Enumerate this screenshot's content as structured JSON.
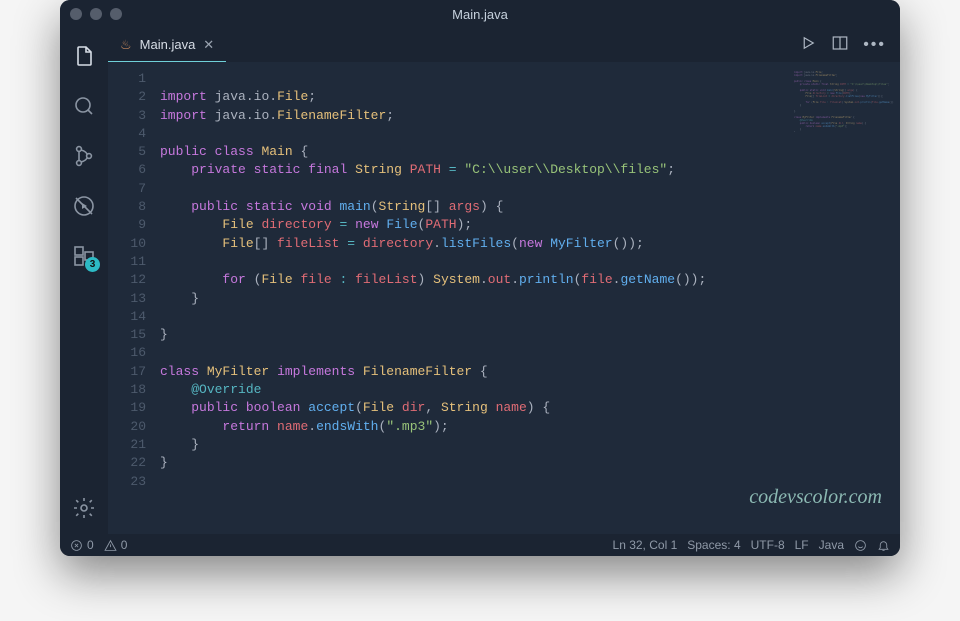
{
  "window": {
    "title": "Main.java"
  },
  "tab": {
    "filename": "Main.java",
    "lang_glyph": "♨"
  },
  "activity": {
    "extensions_badge": "3"
  },
  "status": {
    "errors": "0",
    "warnings": "0",
    "cursor": "Ln 32, Col 1",
    "spaces": "Spaces: 4",
    "encoding": "UTF-8",
    "eol": "LF",
    "language": "Java"
  },
  "watermark": "codevscolor.com",
  "code": {
    "line_count": 23,
    "lines": [
      {
        "n": 1,
        "tokens": []
      },
      {
        "n": 2,
        "tokens": [
          {
            "c": "kw",
            "t": "import"
          },
          {
            "c": "pun",
            "t": " java"
          },
          {
            "c": "pun",
            "t": "."
          },
          {
            "c": "pun",
            "t": "io"
          },
          {
            "c": "pun",
            "t": "."
          },
          {
            "c": "type",
            "t": "File"
          },
          {
            "c": "pun",
            "t": ";"
          }
        ]
      },
      {
        "n": 3,
        "tokens": [
          {
            "c": "kw",
            "t": "import"
          },
          {
            "c": "pun",
            "t": " java"
          },
          {
            "c": "pun",
            "t": "."
          },
          {
            "c": "pun",
            "t": "io"
          },
          {
            "c": "pun",
            "t": "."
          },
          {
            "c": "type",
            "t": "FilenameFilter"
          },
          {
            "c": "pun",
            "t": ";"
          }
        ]
      },
      {
        "n": 4,
        "tokens": []
      },
      {
        "n": 5,
        "tokens": [
          {
            "c": "kw",
            "t": "public"
          },
          {
            "c": "pun",
            "t": " "
          },
          {
            "c": "kw",
            "t": "class"
          },
          {
            "c": "pun",
            "t": " "
          },
          {
            "c": "cls",
            "t": "Main"
          },
          {
            "c": "pun",
            "t": " {"
          }
        ]
      },
      {
        "n": 6,
        "indent": 1,
        "tokens": [
          {
            "c": "kw",
            "t": "private"
          },
          {
            "c": "pun",
            "t": " "
          },
          {
            "c": "kw",
            "t": "static"
          },
          {
            "c": "pun",
            "t": " "
          },
          {
            "c": "kw",
            "t": "final"
          },
          {
            "c": "pun",
            "t": " "
          },
          {
            "c": "type",
            "t": "String"
          },
          {
            "c": "pun",
            "t": " "
          },
          {
            "c": "var",
            "t": "PATH"
          },
          {
            "c": "pun",
            "t": " "
          },
          {
            "c": "op",
            "t": "="
          },
          {
            "c": "pun",
            "t": " "
          },
          {
            "c": "str",
            "t": "\"C:\\\\user\\\\Desktop\\\\files\""
          },
          {
            "c": "pun",
            "t": ";"
          }
        ]
      },
      {
        "n": 7,
        "tokens": []
      },
      {
        "n": 8,
        "indent": 1,
        "tokens": [
          {
            "c": "kw",
            "t": "public"
          },
          {
            "c": "pun",
            "t": " "
          },
          {
            "c": "kw",
            "t": "static"
          },
          {
            "c": "pun",
            "t": " "
          },
          {
            "c": "kw",
            "t": "void"
          },
          {
            "c": "pun",
            "t": " "
          },
          {
            "c": "fn",
            "t": "main"
          },
          {
            "c": "pun",
            "t": "("
          },
          {
            "c": "type",
            "t": "String"
          },
          {
            "c": "pun",
            "t": "[] "
          },
          {
            "c": "var",
            "t": "args"
          },
          {
            "c": "pun",
            "t": ") {"
          }
        ]
      },
      {
        "n": 9,
        "indent": 2,
        "tokens": [
          {
            "c": "type",
            "t": "File"
          },
          {
            "c": "pun",
            "t": " "
          },
          {
            "c": "var",
            "t": "directory"
          },
          {
            "c": "pun",
            "t": " "
          },
          {
            "c": "op",
            "t": "="
          },
          {
            "c": "pun",
            "t": " "
          },
          {
            "c": "kw",
            "t": "new"
          },
          {
            "c": "pun",
            "t": " "
          },
          {
            "c": "fn",
            "t": "File"
          },
          {
            "c": "pun",
            "t": "("
          },
          {
            "c": "var",
            "t": "PATH"
          },
          {
            "c": "pun",
            "t": ");"
          }
        ]
      },
      {
        "n": 10,
        "indent": 2,
        "tokens": [
          {
            "c": "type",
            "t": "File"
          },
          {
            "c": "pun",
            "t": "[] "
          },
          {
            "c": "var",
            "t": "fileList"
          },
          {
            "c": "pun",
            "t": " "
          },
          {
            "c": "op",
            "t": "="
          },
          {
            "c": "pun",
            "t": " "
          },
          {
            "c": "var",
            "t": "directory"
          },
          {
            "c": "pun",
            "t": "."
          },
          {
            "c": "fn",
            "t": "listFiles"
          },
          {
            "c": "pun",
            "t": "("
          },
          {
            "c": "kw",
            "t": "new"
          },
          {
            "c": "pun",
            "t": " "
          },
          {
            "c": "fn",
            "t": "MyFilter"
          },
          {
            "c": "pun",
            "t": "());"
          }
        ]
      },
      {
        "n": 11,
        "tokens": []
      },
      {
        "n": 12,
        "indent": 2,
        "tokens": [
          {
            "c": "kw",
            "t": "for"
          },
          {
            "c": "pun",
            "t": " ("
          },
          {
            "c": "type",
            "t": "File"
          },
          {
            "c": "pun",
            "t": " "
          },
          {
            "c": "var",
            "t": "file"
          },
          {
            "c": "pun",
            "t": " "
          },
          {
            "c": "op",
            "t": ":"
          },
          {
            "c": "pun",
            "t": " "
          },
          {
            "c": "var",
            "t": "fileList"
          },
          {
            "c": "pun",
            "t": ") "
          },
          {
            "c": "type",
            "t": "System"
          },
          {
            "c": "pun",
            "t": "."
          },
          {
            "c": "var",
            "t": "out"
          },
          {
            "c": "pun",
            "t": "."
          },
          {
            "c": "fn",
            "t": "println"
          },
          {
            "c": "pun",
            "t": "("
          },
          {
            "c": "var",
            "t": "file"
          },
          {
            "c": "pun",
            "t": "."
          },
          {
            "c": "fn",
            "t": "getName"
          },
          {
            "c": "pun",
            "t": "());"
          }
        ]
      },
      {
        "n": 13,
        "indent": 1,
        "tokens": [
          {
            "c": "pun",
            "t": "}"
          }
        ]
      },
      {
        "n": 14,
        "tokens": []
      },
      {
        "n": 15,
        "tokens": [
          {
            "c": "pun",
            "t": "}"
          }
        ]
      },
      {
        "n": 16,
        "tokens": []
      },
      {
        "n": 17,
        "tokens": [
          {
            "c": "kw",
            "t": "class"
          },
          {
            "c": "pun",
            "t": " "
          },
          {
            "c": "cls",
            "t": "MyFilter"
          },
          {
            "c": "pun",
            "t": " "
          },
          {
            "c": "kw",
            "t": "implements"
          },
          {
            "c": "pun",
            "t": " "
          },
          {
            "c": "type",
            "t": "FilenameFilter"
          },
          {
            "c": "pun",
            "t": " {"
          }
        ]
      },
      {
        "n": 18,
        "indent": 1,
        "tokens": [
          {
            "c": "ann",
            "t": "@Override"
          }
        ]
      },
      {
        "n": 19,
        "indent": 1,
        "tokens": [
          {
            "c": "kw",
            "t": "public"
          },
          {
            "c": "pun",
            "t": " "
          },
          {
            "c": "kw",
            "t": "boolean"
          },
          {
            "c": "pun",
            "t": " "
          },
          {
            "c": "fn",
            "t": "accept"
          },
          {
            "c": "pun",
            "t": "("
          },
          {
            "c": "type",
            "t": "File"
          },
          {
            "c": "pun",
            "t": " "
          },
          {
            "c": "var",
            "t": "dir"
          },
          {
            "c": "pun",
            "t": ", "
          },
          {
            "c": "type",
            "t": "String"
          },
          {
            "c": "pun",
            "t": " "
          },
          {
            "c": "var",
            "t": "name"
          },
          {
            "c": "pun",
            "t": ") {"
          }
        ]
      },
      {
        "n": 20,
        "indent": 2,
        "tokens": [
          {
            "c": "kw",
            "t": "return"
          },
          {
            "c": "pun",
            "t": " "
          },
          {
            "c": "var",
            "t": "name"
          },
          {
            "c": "pun",
            "t": "."
          },
          {
            "c": "fn",
            "t": "endsWith"
          },
          {
            "c": "pun",
            "t": "("
          },
          {
            "c": "str",
            "t": "\".mp3\""
          },
          {
            "c": "pun",
            "t": ");"
          }
        ]
      },
      {
        "n": 21,
        "indent": 1,
        "tokens": [
          {
            "c": "pun",
            "t": "}"
          }
        ]
      },
      {
        "n": 22,
        "tokens": [
          {
            "c": "pun",
            "t": "}"
          }
        ]
      },
      {
        "n": 23,
        "tokens": []
      }
    ]
  }
}
